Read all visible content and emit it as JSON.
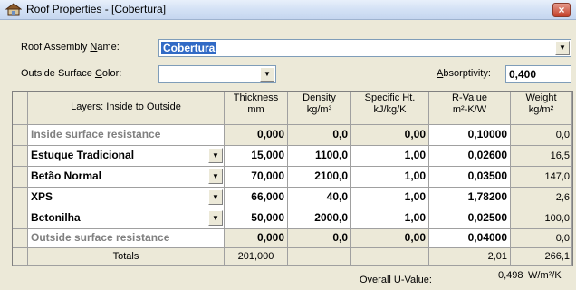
{
  "window": {
    "title": "Roof Properties - [Cobertura]",
    "close": "×"
  },
  "form": {
    "name_label_pre": "Roof Assembly ",
    "name_label_u": "N",
    "name_label_post": "ame:",
    "name_value": "Cobertura",
    "color_label_pre": "Outside Surface ",
    "color_label_u": "C",
    "color_label_post": "olor:",
    "color_value": "",
    "absorp_label_u": "A",
    "absorp_label_post": "bsorptivity:",
    "absorp_value": "0,400"
  },
  "table": {
    "headers": {
      "layers": "Layers: Inside to Outside",
      "thickness": [
        "Thickness",
        "mm"
      ],
      "density": [
        "Density",
        "kg/m³"
      ],
      "specific_heat": [
        "Specific Ht.",
        "kJ/kg/K"
      ],
      "r_value": [
        "R-Value",
        "m²-K/W"
      ],
      "weight": [
        "Weight",
        "kg/m²"
      ]
    },
    "rows": [
      {
        "name": "Inside surface resistance",
        "fixed": true,
        "thickness": "0,000",
        "density": "0,0",
        "sh": "0,00",
        "r": "0,10000",
        "weight": "0,0"
      },
      {
        "name": "Estuque Tradicional",
        "fixed": false,
        "thickness": "15,000",
        "density": "1100,0",
        "sh": "1,00",
        "r": "0,02600",
        "weight": "16,5"
      },
      {
        "name": "Betão Normal",
        "fixed": false,
        "thickness": "70,000",
        "density": "2100,0",
        "sh": "1,00",
        "r": "0,03500",
        "weight": "147,0"
      },
      {
        "name": "XPS",
        "fixed": false,
        "thickness": "66,000",
        "density": "40,0",
        "sh": "1,00",
        "r": "1,78200",
        "weight": "2,6"
      },
      {
        "name": "Betonilha",
        "fixed": false,
        "thickness": "50,000",
        "density": "2000,0",
        "sh": "1,00",
        "r": "0,02500",
        "weight": "100,0"
      },
      {
        "name": "Outside surface resistance",
        "fixed": true,
        "thickness": "0,000",
        "density": "0,0",
        "sh": "0,00",
        "r": "0,04000",
        "weight": "0,0"
      }
    ],
    "totals": {
      "label": "Totals",
      "thickness": "201,000",
      "r": "2,01",
      "weight": "266,1"
    }
  },
  "u_value": {
    "label": "Overall U-Value:",
    "value": "0,498",
    "unit": "W/m²/K"
  }
}
